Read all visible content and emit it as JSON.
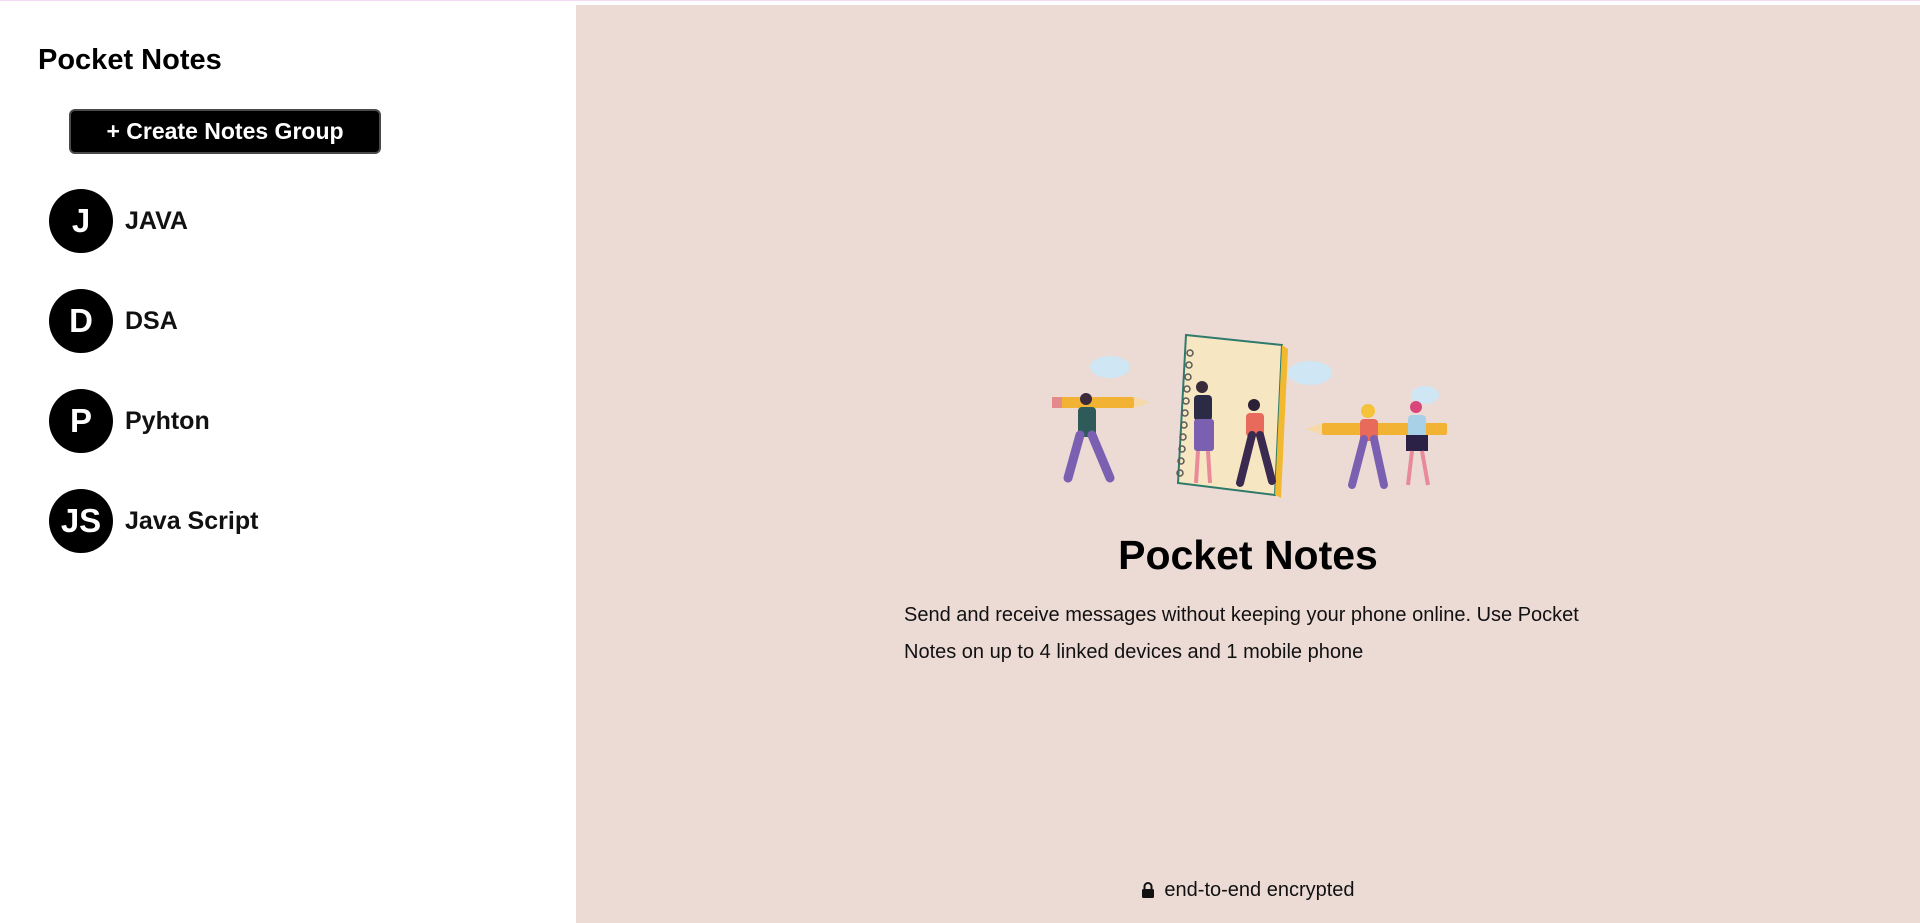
{
  "sidebar": {
    "title": "Pocket Notes",
    "create_button_label": "+ Create Notes Group",
    "groups": [
      {
        "initials": "J",
        "name": "JAVA"
      },
      {
        "initials": "D",
        "name": "DSA"
      },
      {
        "initials": "P",
        "name": "Pyhton"
      },
      {
        "initials": "JS",
        "name": "Java Script"
      }
    ]
  },
  "main": {
    "title": "Pocket Notes",
    "description": "Send and receive messages without keeping your phone online. Use Pocket Notes on up to 4 linked devices and 1 mobile phone",
    "footer_text": "end-to-end encrypted",
    "footer_icon": "lock-icon",
    "background_color": "#ecdad5"
  }
}
